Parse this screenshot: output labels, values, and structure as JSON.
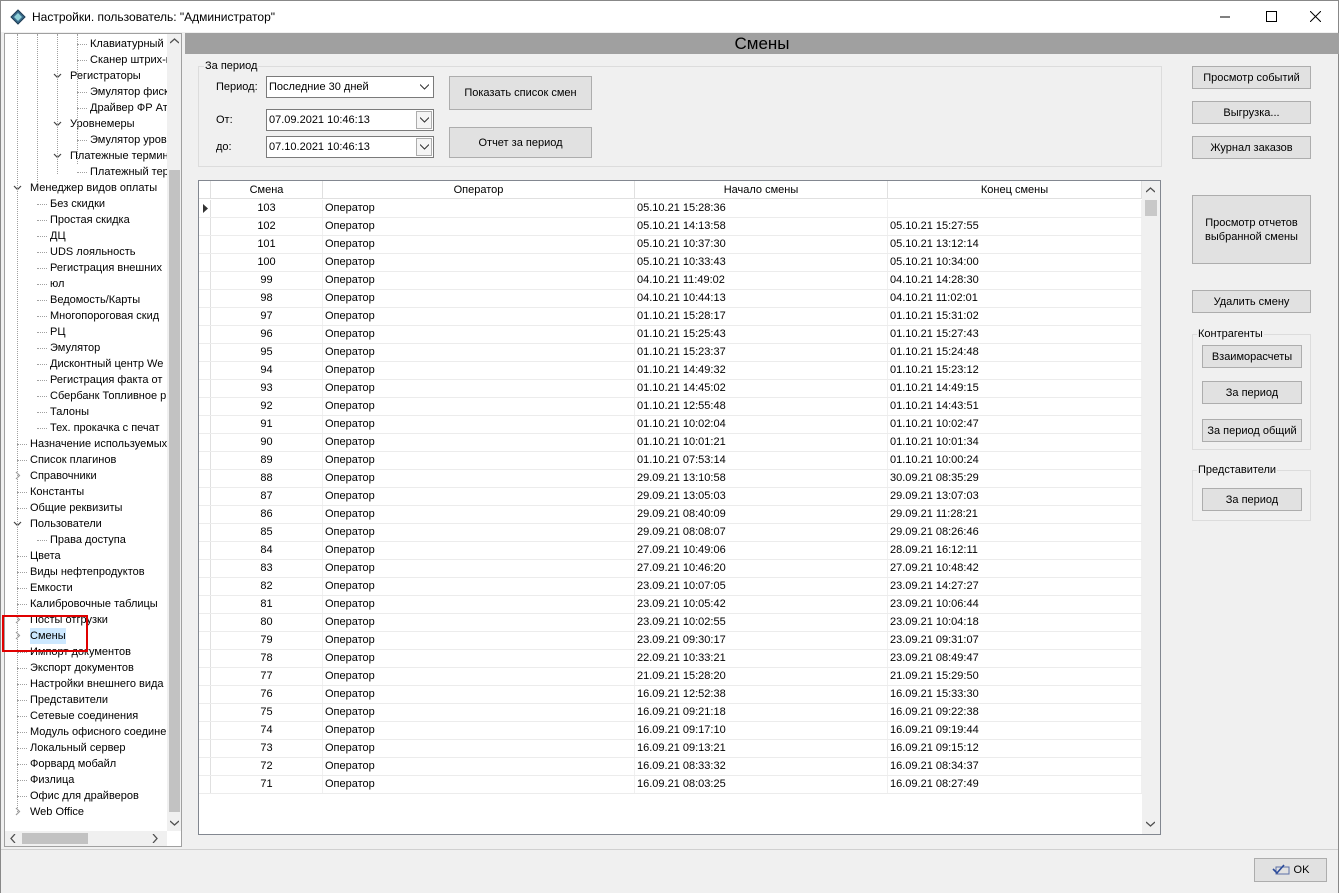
{
  "window": {
    "title": "Настройки. пользователь: \"Администратор\"",
    "minimize": "minimize",
    "maximize": "maximize",
    "close": "close"
  },
  "tree": {
    "items": [
      {
        "label": "Клавиатурный иде",
        "indent": 3,
        "expander": ""
      },
      {
        "label": "Сканер штрих-код",
        "indent": 3,
        "expander": ""
      },
      {
        "label": "Регистраторы",
        "indent": 2,
        "expander": "v"
      },
      {
        "label": "Эмулятор фискаль",
        "indent": 3,
        "expander": ""
      },
      {
        "label": "Драйвер ФР Атол с",
        "indent": 3,
        "expander": ""
      },
      {
        "label": "Уровнемеры",
        "indent": 2,
        "expander": "v"
      },
      {
        "label": "Эмулятор уровнем",
        "indent": 3,
        "expander": ""
      },
      {
        "label": "Платежные терминал",
        "indent": 2,
        "expander": "v"
      },
      {
        "label": "Платежный терми",
        "indent": 3,
        "expander": ""
      },
      {
        "label": "Менеджер видов оплаты",
        "indent": 0,
        "expander": "v"
      },
      {
        "label": "Без скидки",
        "indent": 1,
        "expander": ""
      },
      {
        "label": "Простая скидка",
        "indent": 1,
        "expander": ""
      },
      {
        "label": "ДЦ",
        "indent": 1,
        "expander": ""
      },
      {
        "label": "UDS лояльность",
        "indent": 1,
        "expander": ""
      },
      {
        "label": "Регистрация внешних",
        "indent": 1,
        "expander": ""
      },
      {
        "label": "юл",
        "indent": 1,
        "expander": ""
      },
      {
        "label": "Ведомость/Карты",
        "indent": 1,
        "expander": ""
      },
      {
        "label": "Многопороговая скид",
        "indent": 1,
        "expander": ""
      },
      {
        "label": "РЦ",
        "indent": 1,
        "expander": ""
      },
      {
        "label": "Эмулятор",
        "indent": 1,
        "expander": ""
      },
      {
        "label": "Дисконтный центр We",
        "indent": 1,
        "expander": ""
      },
      {
        "label": "Регистрация факта от",
        "indent": 1,
        "expander": ""
      },
      {
        "label": "Сбербанк Топливное р",
        "indent": 1,
        "expander": ""
      },
      {
        "label": "Талоны",
        "indent": 1,
        "expander": ""
      },
      {
        "label": "Тех. прокачка с печат",
        "indent": 1,
        "expander": ""
      },
      {
        "label": "Назначение используемых",
        "indent": 0,
        "expander": ""
      },
      {
        "label": "Список плагинов",
        "indent": 0,
        "expander": ""
      },
      {
        "label": "Справочники",
        "indent": 0,
        "expander": ">"
      },
      {
        "label": "Константы",
        "indent": 0,
        "expander": ""
      },
      {
        "label": "Общие реквизиты",
        "indent": 0,
        "expander": ""
      },
      {
        "label": "Пользователи",
        "indent": 0,
        "expander": "v"
      },
      {
        "label": "Права доступа",
        "indent": 1,
        "expander": ""
      },
      {
        "label": "Цвета",
        "indent": 0,
        "expander": ""
      },
      {
        "label": "Виды нефтепродуктов",
        "indent": 0,
        "expander": ""
      },
      {
        "label": "Емкости",
        "indent": 0,
        "expander": ""
      },
      {
        "label": "Калибровочные таблицы",
        "indent": 0,
        "expander": ""
      },
      {
        "label": "Посты отгрузки",
        "indent": 0,
        "expander": ">"
      },
      {
        "label": "Смены",
        "indent": 0,
        "expander": ">",
        "selected": true
      },
      {
        "label": "Импорт документов",
        "indent": 0,
        "expander": ""
      },
      {
        "label": "Экспорт документов",
        "indent": 0,
        "expander": ""
      },
      {
        "label": "Настройки внешнего вида",
        "indent": 0,
        "expander": ""
      },
      {
        "label": "Представители",
        "indent": 0,
        "expander": ""
      },
      {
        "label": "Сетевые соединения",
        "indent": 0,
        "expander": ""
      },
      {
        "label": "Модуль офисного соедине",
        "indent": 0,
        "expander": ""
      },
      {
        "label": "Локальный сервер",
        "indent": 0,
        "expander": ""
      },
      {
        "label": "Форвард мобайл",
        "indent": 0,
        "expander": ""
      },
      {
        "label": "Физлица",
        "indent": 0,
        "expander": ""
      },
      {
        "label": "Офис для драйверов",
        "indent": 0,
        "expander": ""
      },
      {
        "label": "Web Office",
        "indent": 0,
        "expander": ">"
      }
    ]
  },
  "header": {
    "title": "Смены"
  },
  "filter": {
    "group_label": "За период",
    "period_label": "Период:",
    "period_value": "Последние 30 дней",
    "from_label": "От:",
    "from_value": "07.09.2021 10:46:13",
    "to_label": "до:",
    "to_value": "07.10.2021 10:46:13",
    "show_button": "Показать список смен",
    "report_button": "Отчет за период"
  },
  "grid": {
    "columns": [
      "Смена",
      "Оператор",
      "Начало смены",
      "Конец смены"
    ],
    "rows": [
      [
        "103",
        "Оператор",
        "05.10.21 15:28:36",
        ""
      ],
      [
        "102",
        "Оператор",
        "05.10.21 14:13:58",
        "05.10.21 15:27:55"
      ],
      [
        "101",
        "Оператор",
        "05.10.21 10:37:30",
        "05.10.21 13:12:14"
      ],
      [
        "100",
        "Оператор",
        "05.10.21 10:33:43",
        "05.10.21 10:34:00"
      ],
      [
        "99",
        "Оператор",
        "04.10.21 11:49:02",
        "04.10.21 14:28:30"
      ],
      [
        "98",
        "Оператор",
        "04.10.21 10:44:13",
        "04.10.21 11:02:01"
      ],
      [
        "97",
        "Оператор",
        "01.10.21 15:28:17",
        "01.10.21 15:31:02"
      ],
      [
        "96",
        "Оператор",
        "01.10.21 15:25:43",
        "01.10.21 15:27:43"
      ],
      [
        "95",
        "Оператор",
        "01.10.21 15:23:37",
        "01.10.21 15:24:48"
      ],
      [
        "94",
        "Оператор",
        "01.10.21 14:49:32",
        "01.10.21 15:23:12"
      ],
      [
        "93",
        "Оператор",
        "01.10.21 14:45:02",
        "01.10.21 14:49:15"
      ],
      [
        "92",
        "Оператор",
        "01.10.21 12:55:48",
        "01.10.21 14:43:51"
      ],
      [
        "91",
        "Оператор",
        "01.10.21 10:02:04",
        "01.10.21 10:02:47"
      ],
      [
        "90",
        "Оператор",
        "01.10.21 10:01:21",
        "01.10.21 10:01:34"
      ],
      [
        "89",
        "Оператор",
        "01.10.21 07:53:14",
        "01.10.21 10:00:24"
      ],
      [
        "88",
        "Оператор",
        "29.09.21 13:10:58",
        "30.09.21 08:35:29"
      ],
      [
        "87",
        "Оператор",
        "29.09.21 13:05:03",
        "29.09.21 13:07:03"
      ],
      [
        "86",
        "Оператор",
        "29.09.21 08:40:09",
        "29.09.21 11:28:21"
      ],
      [
        "85",
        "Оператор",
        "29.09.21 08:08:07",
        "29.09.21 08:26:46"
      ],
      [
        "84",
        "Оператор",
        "27.09.21 10:49:06",
        "28.09.21 16:12:11"
      ],
      [
        "83",
        "Оператор",
        "27.09.21 10:46:20",
        "27.09.21 10:48:42"
      ],
      [
        "82",
        "Оператор",
        "23.09.21 10:07:05",
        "23.09.21 14:27:27"
      ],
      [
        "81",
        "Оператор",
        "23.09.21 10:05:42",
        "23.09.21 10:06:44"
      ],
      [
        "80",
        "Оператор",
        "23.09.21 10:02:55",
        "23.09.21 10:04:18"
      ],
      [
        "79",
        "Оператор",
        "23.09.21 09:30:17",
        "23.09.21 09:31:07"
      ],
      [
        "78",
        "Оператор",
        "22.09.21 10:33:21",
        "23.09.21 08:49:47"
      ],
      [
        "77",
        "Оператор",
        "21.09.21 15:28:20",
        "21.09.21 15:29:50"
      ],
      [
        "76",
        "Оператор",
        "16.09.21 12:52:38",
        "16.09.21 15:33:30"
      ],
      [
        "75",
        "Оператор",
        "16.09.21 09:21:18",
        "16.09.21 09:22:38"
      ],
      [
        "74",
        "Оператор",
        "16.09.21 09:17:10",
        "16.09.21 09:19:44"
      ],
      [
        "73",
        "Оператор",
        "16.09.21 09:13:21",
        "16.09.21 09:15:12"
      ],
      [
        "72",
        "Оператор",
        "16.09.21 08:33:32",
        "16.09.21 08:34:37"
      ],
      [
        "71",
        "Оператор",
        "16.09.21 08:03:25",
        "16.09.21 08:27:49"
      ]
    ]
  },
  "actions": {
    "events": "Просмотр событий",
    "export": "Выгрузка...",
    "orders": "Журнал заказов",
    "reports_line1": "Просмотр отчетов",
    "reports_line2": "выбранной смены",
    "delete": "Удалить смену",
    "contractors_label": "Контрагенты",
    "mutual": "Взаиморасчеты",
    "per_period": "За период",
    "per_period_total": "За период общий",
    "reps_label": "Представители",
    "reps_period": "За период"
  },
  "footer": {
    "ok": "OK"
  }
}
